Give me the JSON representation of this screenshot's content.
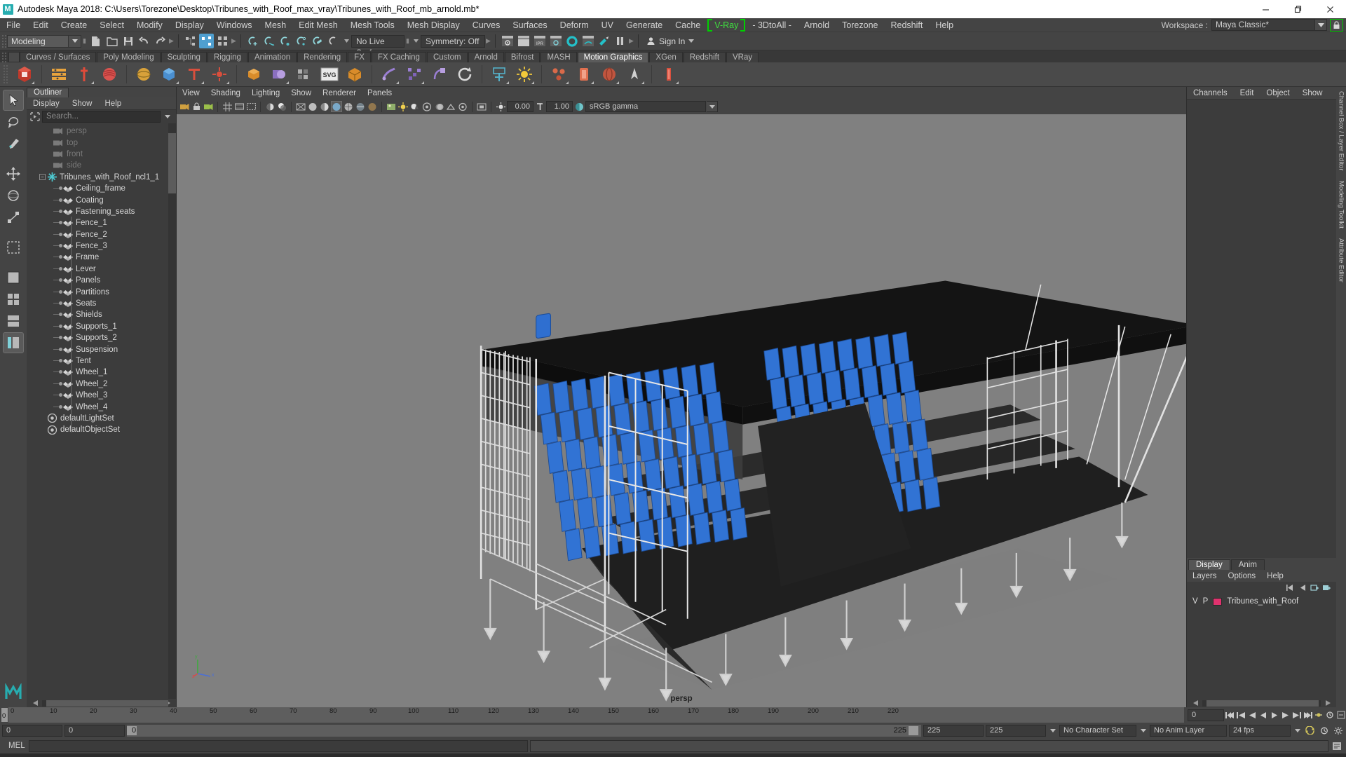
{
  "window": {
    "app_name": "Autodesk Maya 2018",
    "title": "Autodesk Maya 2018: C:\\Users\\Torezone\\Desktop\\Tribunes_with_Roof_max_vray\\Tribunes_with_Roof_mb_arnold.mb*",
    "logo_letter": "M",
    "controls": {
      "minimize": "minimize-icon",
      "restore": "restore-icon",
      "close": "close-icon"
    }
  },
  "menubar": {
    "items": [
      "File",
      "Edit",
      "Create",
      "Select",
      "Modify",
      "Display",
      "Windows",
      "Mesh",
      "Edit Mesh",
      "Mesh Tools",
      "Mesh Display",
      "Curves",
      "Surfaces",
      "Deform",
      "UV",
      "Generate",
      "Cache",
      "V-Ray",
      "- 3DtoAll -",
      "Arnold",
      "Torezone",
      "Redshift",
      "Help"
    ],
    "highlighted": "V-Ray",
    "workspace_label": "Workspace :",
    "workspace_value": "Maya Classic*",
    "lock_icon": "lock-icon"
  },
  "statusbar": {
    "mode": "Modeling",
    "live_surface": "No Live Surface",
    "symmetry": "Symmetry: Off",
    "signin": "Sign In"
  },
  "shelf": {
    "tabs": [
      "Curves / Surfaces",
      "Poly Modeling",
      "Sculpting",
      "Rigging",
      "Animation",
      "Rendering",
      "FX",
      "FX Caching",
      "Custom",
      "Arnold",
      "Bifrost",
      "MASH",
      "Motion Graphics",
      "XGen",
      "Redshift",
      "VRay"
    ],
    "active_tab": "Motion Graphics"
  },
  "outliner": {
    "tab_label": "Outliner",
    "menu": [
      "Display",
      "Show",
      "Help"
    ],
    "search_placeholder": "Search...",
    "cameras": [
      "persp",
      "top",
      "front",
      "side"
    ],
    "root": "Tribunes_with_Roof_ncl1_1",
    "children": [
      "Ceiling_frame",
      "Coating",
      "Fastening_seats",
      "Fence_1",
      "Fence_2",
      "Fence_3",
      "Frame",
      "Lever",
      "Panels",
      "Partitions",
      "Seats",
      "Shields",
      "Supports_1",
      "Supports_2",
      "Suspension",
      "Tent",
      "Wheel_1",
      "Wheel_2",
      "Wheel_3",
      "Wheel_4"
    ],
    "sets": [
      "defaultLightSet",
      "defaultObjectSet"
    ]
  },
  "viewport": {
    "menu": [
      "View",
      "Shading",
      "Lighting",
      "Show",
      "Renderer",
      "Panels"
    ],
    "exposure_value": "0.00",
    "gamma_value": "1.00",
    "color_management": "sRGB gamma",
    "camera_label": "persp",
    "background_color": "#808080",
    "seat_color": "#2f6fd0",
    "structure_color": "#d8d8d8",
    "roof_color": "#1a1a1a"
  },
  "right_panel": {
    "tabs": [
      "Channels",
      "Edit",
      "Object",
      "Show"
    ],
    "layer_tabs": [
      "Display",
      "Anim"
    ],
    "active_layer_tab": "Display",
    "layer_menu": [
      "Layers",
      "Options",
      "Help"
    ],
    "columns": [
      "V",
      "P"
    ],
    "layers": [
      {
        "v": "V",
        "p": "P",
        "color": "#e0326e",
        "name": "Tribunes_with_Roof"
      }
    ]
  },
  "vertical_tabs": [
    "Channel Box / Layer Editor",
    "Modeling Toolkit",
    "Attribute Editor"
  ],
  "timeline": {
    "current_frame": "0",
    "start_frame": "0",
    "end_frame": "225",
    "range_start": "0",
    "range_end": "225",
    "playback_start": "225",
    "playback_end": "225",
    "anim_start_field": "0",
    "anim_end_field": "0",
    "range_field_left": "0",
    "ticks": [
      "0",
      "10",
      "20",
      "30",
      "40",
      "50",
      "60",
      "70",
      "80",
      "90",
      "100",
      "110",
      "120",
      "130",
      "140",
      "150",
      "160",
      "170",
      "180",
      "190",
      "200",
      "210",
      "220"
    ],
    "character_set": "No Character Set",
    "anim_layer": "No Anim Layer",
    "fps": "24 fps"
  },
  "command_line": {
    "label": "MEL",
    "input_value": "",
    "output_value": ""
  }
}
